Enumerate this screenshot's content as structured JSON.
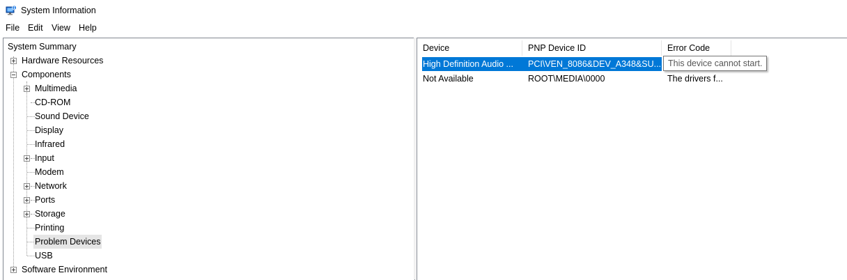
{
  "window": {
    "title": "System Information"
  },
  "menu": [
    "File",
    "Edit",
    "View",
    "Help"
  ],
  "tree": {
    "root": "System Summary",
    "hardware_resources": "Hardware Resources",
    "components": "Components",
    "children": [
      "Multimedia",
      "CD-ROM",
      "Sound Device",
      "Display",
      "Infrared",
      "Input",
      "Modem",
      "Network",
      "Ports",
      "Storage",
      "Printing",
      "Problem Devices",
      "USB"
    ],
    "software_environment": "Software Environment"
  },
  "list": {
    "columns": [
      "Device",
      "PNP Device ID",
      "Error Code"
    ],
    "rows": [
      [
        "High Definition Audio ...",
        "PCI\\VEN_8086&DEV_A348&SU...",
        "This device cannot start."
      ],
      [
        "Not Available",
        "ROOT\\MEDIA\\0000",
        "The drivers f..."
      ]
    ]
  },
  "tooltip": {
    "text": "This device cannot start."
  },
  "colors": {
    "selection": "#0078d7",
    "tree_selected": "#e5e5e5"
  }
}
